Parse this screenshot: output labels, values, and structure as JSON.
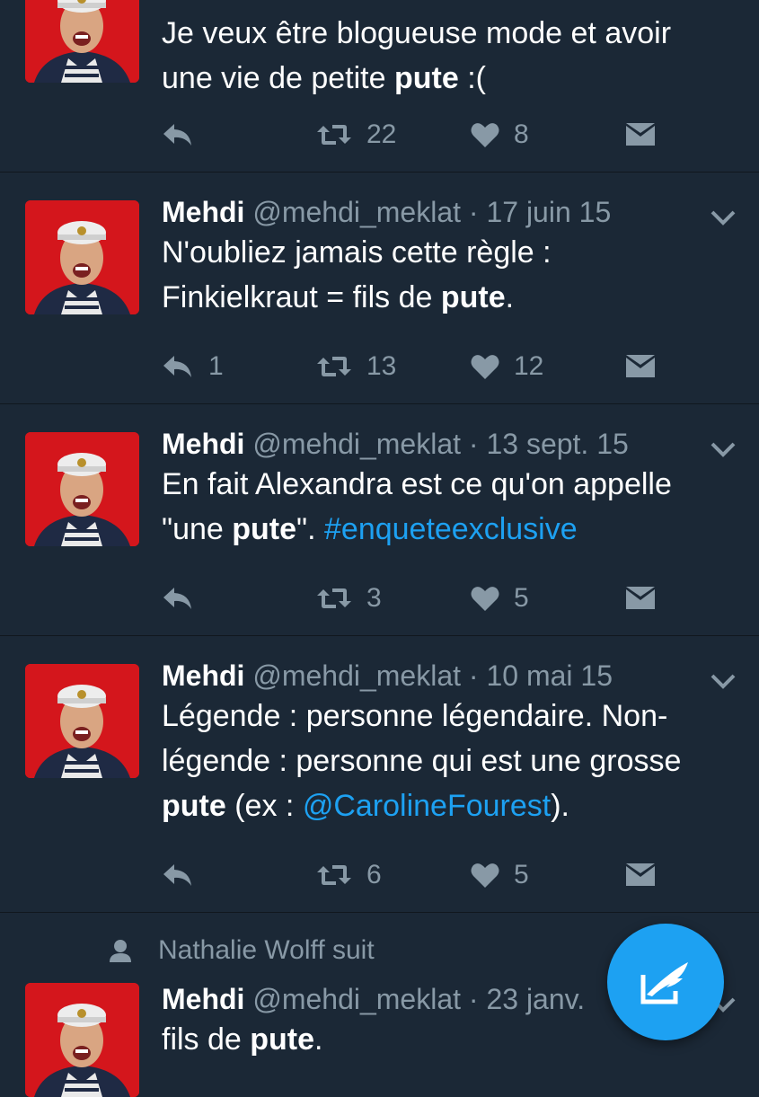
{
  "colors": {
    "background": "#1b2836",
    "accent": "#1da1f2",
    "muted": "#8899a6",
    "avatar_bg": "#d4161c"
  },
  "tweets": [
    {
      "text": [
        "Je veux être blogueuse mode et avoir",
        "une vie de petite ",
        "pute",
        " :("
      ],
      "reply_count": "",
      "retweet_count": "22",
      "like_count": "8"
    },
    {
      "name": "Mehdi",
      "handle": "@mehdi_meklat",
      "date": "· 17 juin 15",
      "text": [
        "N'oubliez jamais cette règle :",
        "Finkielkraut = fils de ",
        "pute",
        "."
      ],
      "reply_count": "1",
      "retweet_count": "13",
      "like_count": "12"
    },
    {
      "name": "Mehdi",
      "handle": "@mehdi_meklat",
      "date": "· 13 sept. 15",
      "text": [
        "En fait Alexandra est ce qu'on appelle",
        "\"une ",
        "pute",
        "\". ",
        "#enqueteexclusive"
      ],
      "reply_count": "",
      "retweet_count": "3",
      "like_count": "5"
    },
    {
      "name": "Mehdi",
      "handle": "@mehdi_meklat",
      "date": "· 10 mai 15",
      "text": [
        "Légende : personne légendaire. Non-",
        "légende : personne qui est une grosse",
        "pute",
        " (ex : ",
        "@CarolineFourest",
        ")."
      ],
      "reply_count": "",
      "retweet_count": "6",
      "like_count": "5"
    },
    {
      "social_context": "Nathalie Wolff suit",
      "name": "Mehdi",
      "handle": "@mehdi_meklat",
      "date": "· 23 janv.",
      "text": [
        "fils de ",
        "pute",
        "."
      ]
    }
  ],
  "icons": {
    "reply": "reply-icon",
    "retweet": "retweet-icon",
    "like": "heart-icon",
    "dm": "direct-message-icon",
    "caret": "chevron-down-icon",
    "follow": "person-icon",
    "compose": "compose-tweet-icon"
  }
}
